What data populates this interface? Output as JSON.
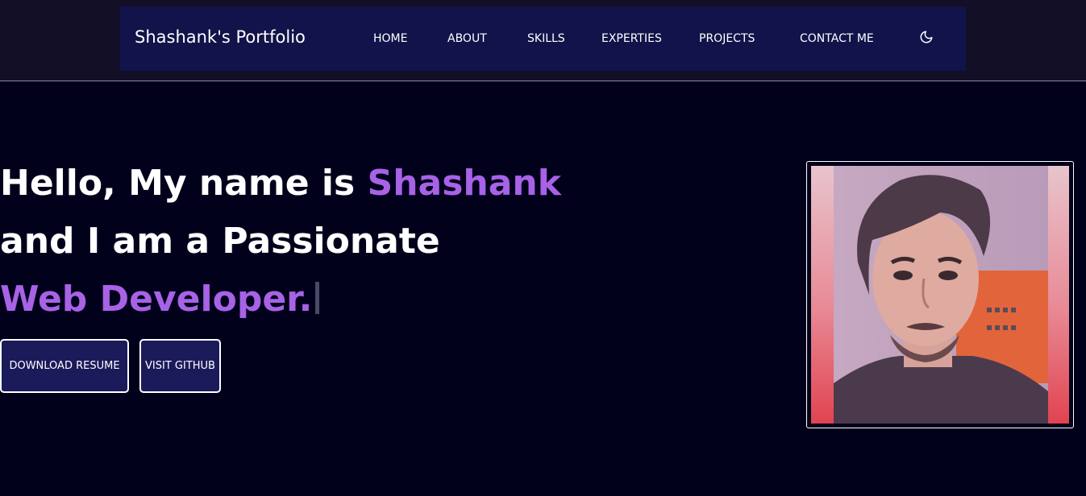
{
  "nav": {
    "brand": "Shashank's Portfolio",
    "links": [
      "HOME",
      "ABOUT",
      "SKILLS",
      "EXPERTIES",
      "PROJECTS",
      "CONTACT ME"
    ],
    "theme_icon": "moon-icon"
  },
  "hero": {
    "line1_prefix": "Hello, My name is ",
    "line1_name": "Shashank",
    "line2": "and I am a Passionate",
    "line3": "Web Developer."
  },
  "buttons": {
    "download": "DOWNLOAD RESUME",
    "github": "VISIT GITHUB"
  },
  "colors": {
    "background": "#02011c",
    "navbar": "#12134a",
    "accent": "#a762e6",
    "button": "#1b1a5a"
  }
}
